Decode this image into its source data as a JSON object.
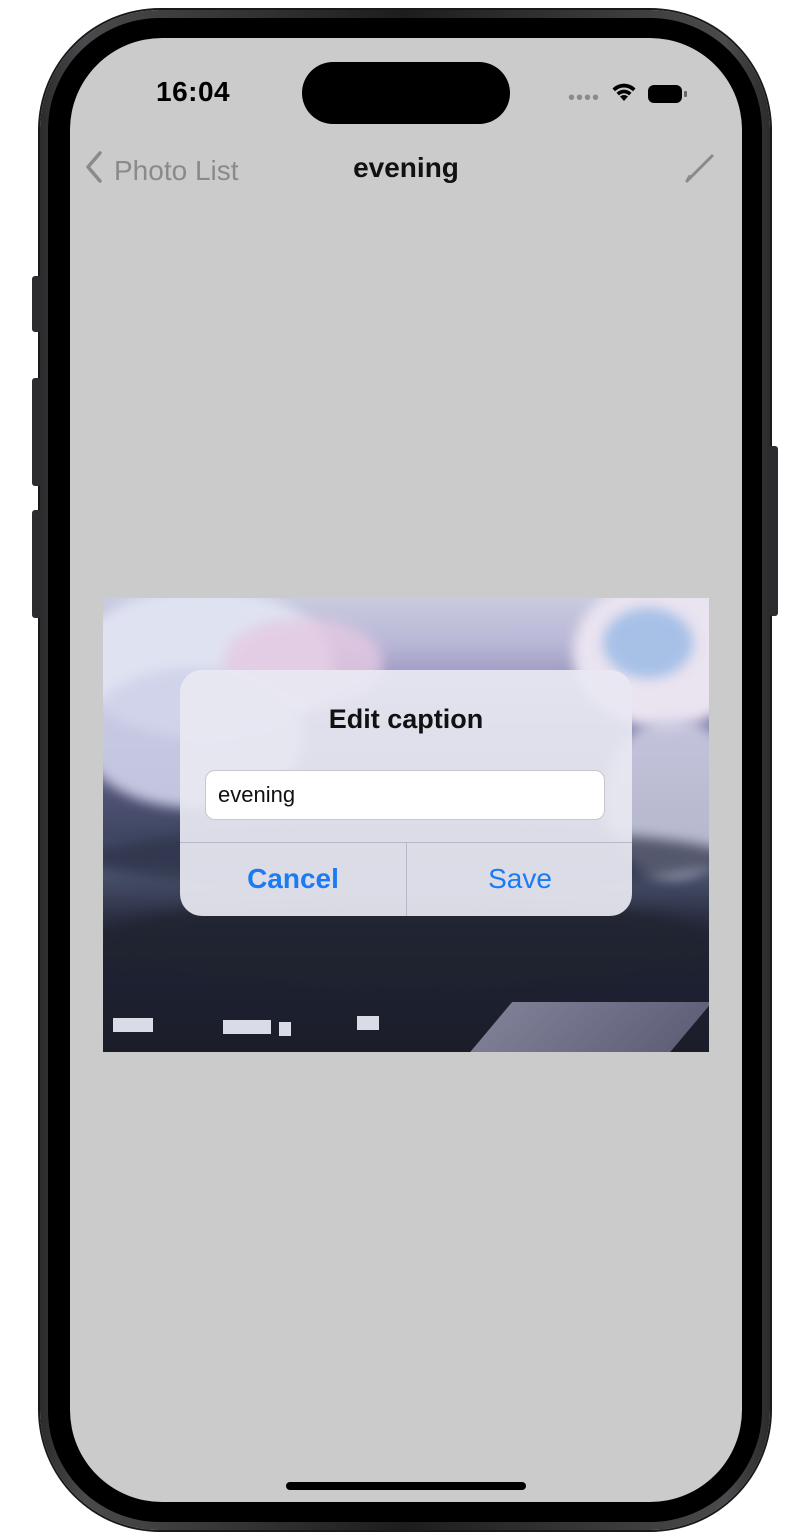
{
  "status_bar": {
    "time": "16:04",
    "signal_icon": "cellular-dots-icon",
    "wifi_icon": "wifi-icon",
    "battery_icon": "battery-icon"
  },
  "nav": {
    "back_icon": "chevron-left-icon",
    "back_label": "Photo List",
    "title": "evening",
    "edit_icon": "pencil-icon"
  },
  "photo": {
    "description_icon": "photo-image"
  },
  "dialog": {
    "title": "Edit caption",
    "input_value": "evening",
    "cancel_label": "Cancel",
    "save_label": "Save"
  },
  "colors": {
    "screen_bg": "#cbcbcb",
    "accent": "#1a7bf2",
    "nav_secondary": "#8a8a8a"
  }
}
